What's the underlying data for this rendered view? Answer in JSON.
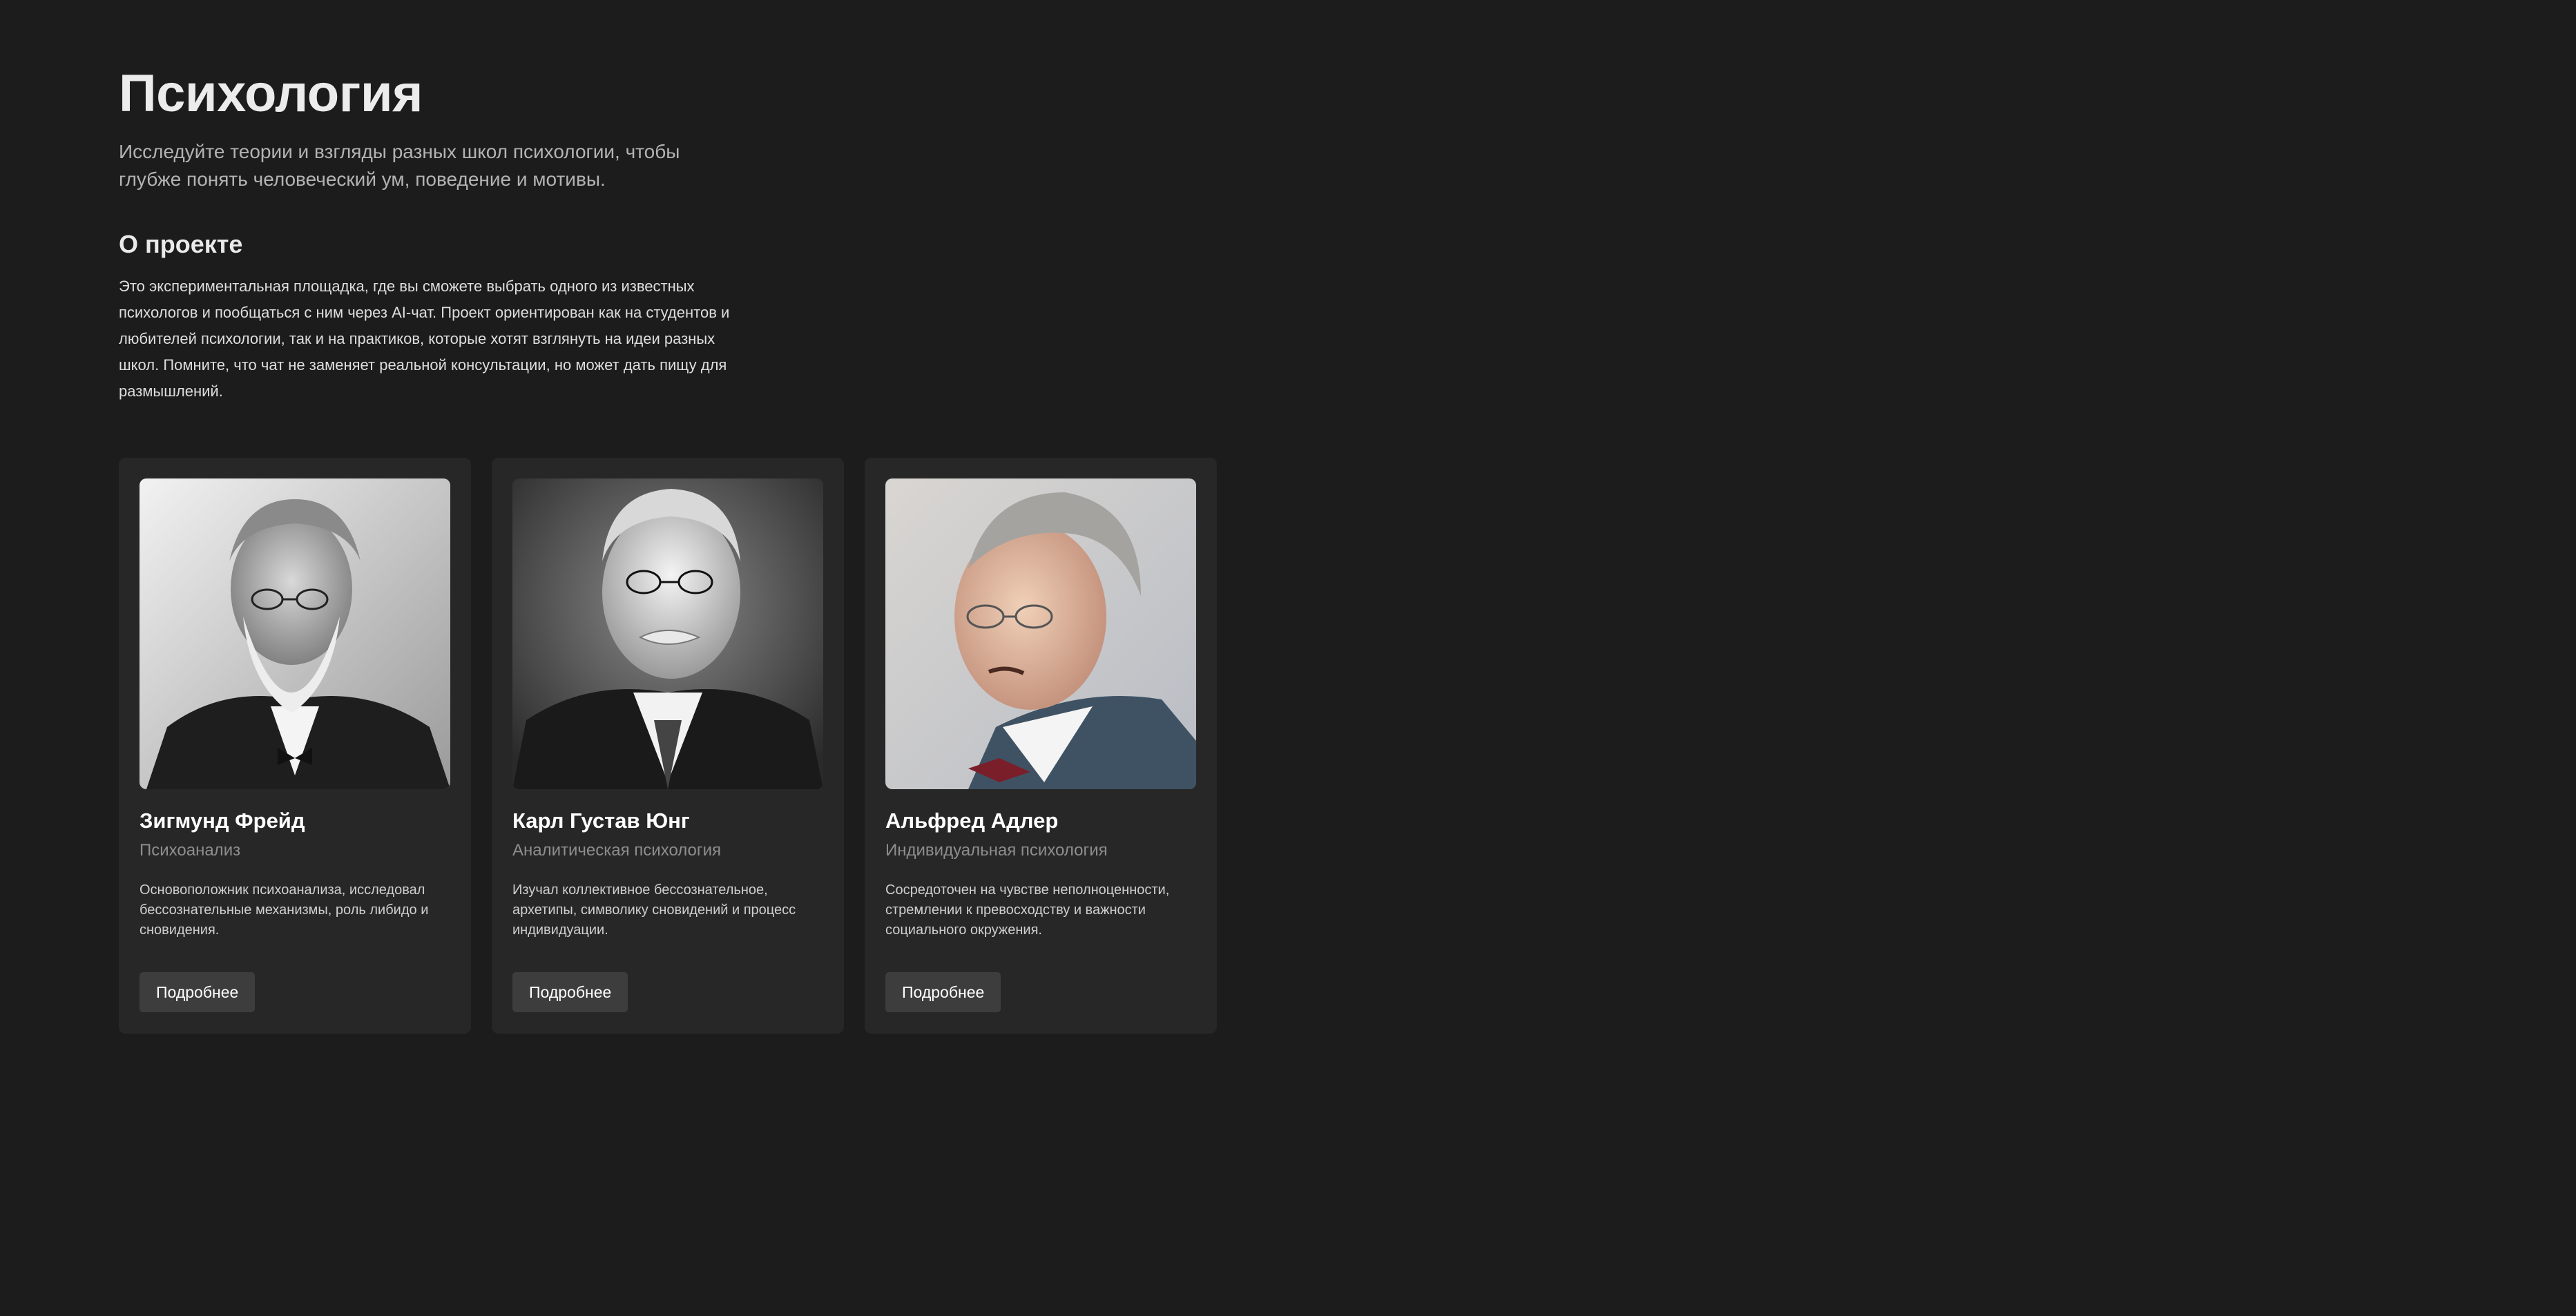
{
  "header": {
    "title": "Психология",
    "subtitle": "Исследуйте теории и взгляды разных школ психологии, чтобы глубже понять человеческий ум, поведение и мотивы."
  },
  "about": {
    "title": "О проекте",
    "text": "Это экспериментальная площадка, где вы сможете выбрать одного из известных психологов и пообщаться с ним через AI-чат. Проект ориентирован как на студентов и любителей психологии, так и на практиков, которые хотят взглянуть на идеи разных школ. Помните, что чат не заменяет реальной консультации, но может дать пищу для размышлений."
  },
  "cards": [
    {
      "name": "Зигмунд Фрейд",
      "school": "Психоанализ",
      "description": "Основоположник психоанализа, исследовал бессознательные механизмы, роль либидо и сновидения.",
      "button_label": "Подробнее"
    },
    {
      "name": "Карл Густав Юнг",
      "school": "Аналитическая психология",
      "description": "Изучал коллективное бессознательное, архетипы, символику сновидений и процесс индивидуации.",
      "button_label": "Подробнее"
    },
    {
      "name": "Альфред Адлер",
      "school": "Индивидуальная психология",
      "description": "Сосредоточен на чувстве неполноценности, стремлении к превосходству и важности социального окружения.",
      "button_label": "Подробнее"
    }
  ],
  "colors": {
    "background": "#1c1c1c",
    "card": "#272727",
    "button": "#3d3d3d"
  }
}
